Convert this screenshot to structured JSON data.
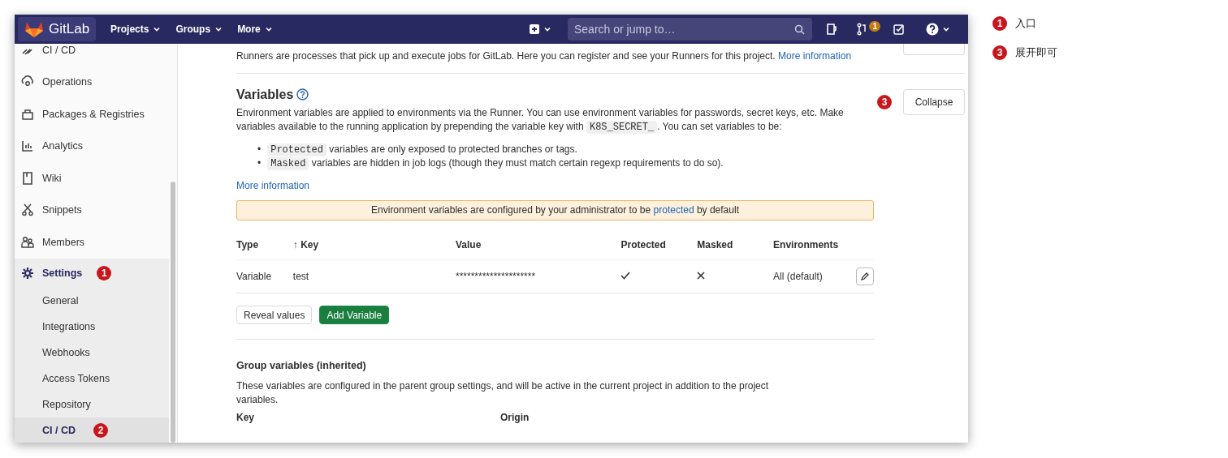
{
  "navbar": {
    "logo": "GitLab",
    "menus": [
      {
        "label": "Projects"
      },
      {
        "label": "Groups"
      },
      {
        "label": "More"
      }
    ],
    "search": {
      "placeholder": "Search or jump to…"
    },
    "merge_request_count": "1"
  },
  "sidebar": {
    "items": [
      {
        "label": "CI / CD",
        "selected": false
      },
      {
        "label": "Operations",
        "selected": false
      },
      {
        "label": "Packages & Registries",
        "selected": false
      },
      {
        "label": "Analytics",
        "selected": false
      },
      {
        "label": "Wiki",
        "selected": false
      },
      {
        "label": "Snippets",
        "selected": false
      },
      {
        "label": "Members",
        "selected": false
      },
      {
        "label": "Settings",
        "selected": true,
        "marker": "1",
        "children": [
          {
            "label": "General",
            "selected": false
          },
          {
            "label": "Integrations",
            "selected": false
          },
          {
            "label": "Webhooks",
            "selected": false
          },
          {
            "label": "Access Tokens",
            "selected": false
          },
          {
            "label": "Repository",
            "selected": false
          },
          {
            "label": "CI / CD",
            "selected": true,
            "marker": "2"
          }
        ]
      }
    ]
  },
  "runners": {
    "text": "Runners are processes that pick up and execute jobs for GitLab. Here you can register and see your Runners for this project.",
    "link": "More information"
  },
  "variables": {
    "title": "Variables",
    "collapse_button": "Collapse",
    "collapse_marker": "3",
    "description": [
      {
        "kind": "text",
        "text": "Environment variables are applied to environments via the Runner. You can use environment variables for passwords, secret keys, etc. Make variables available to the running application by prepending the variable key with "
      },
      {
        "kind": "code",
        "text": "K8S_SECRET_"
      },
      {
        "kind": "text",
        "text": ". You can set variables to be:"
      }
    ],
    "bullets": [
      {
        "bullet": "•",
        "code": "Protected",
        "text": "variables are only exposed to protected branches or tags."
      },
      {
        "bullet": "•",
        "code": "Masked",
        "text": "variables are hidden in job logs (though they must match certain regexp requirements to do so)."
      }
    ],
    "link": "More information",
    "alert": [
      {
        "kind": "text",
        "text": "Environment variables are configured by your administrator to be "
      },
      {
        "kind": "link",
        "text": "protected"
      },
      {
        "kind": "text",
        "text": " by default"
      }
    ],
    "table": {
      "columns": [
        "Type",
        "↑ Key",
        "Value",
        "Protected",
        "Masked",
        "Environments"
      ],
      "rows": [
        {
          "type": "Variable",
          "key": "test",
          "value": "*********************",
          "protected": true,
          "masked": false,
          "environments": "All (default)"
        }
      ]
    },
    "buttons": [
      {
        "label": "Reveal values",
        "kind": "default"
      },
      {
        "label": "Add Variable",
        "kind": "primary"
      }
    ]
  },
  "group_variables": {
    "title": "Group variables (inherited)",
    "text": "These variables are configured in the parent group settings, and will be active in the current project in addition to the project variables.",
    "columns": [
      "Key",
      "Origin"
    ]
  },
  "legend": [
    {
      "marker": "1",
      "label": "入口"
    },
    {
      "marker": "3",
      "label": "展开即可"
    }
  ]
}
